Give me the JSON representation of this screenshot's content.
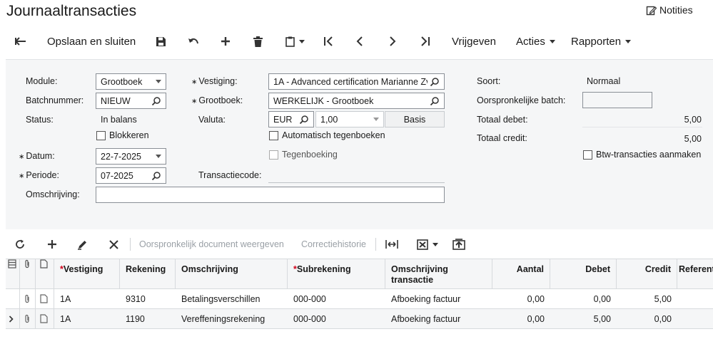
{
  "header": {
    "title": "Journaaltransacties",
    "notes_label": "Notities"
  },
  "toolbar": {
    "save_close": "Opslaan en sluiten",
    "release": "Vrijgeven",
    "actions": "Acties",
    "reports": "Rapporten"
  },
  "form": {
    "module_label": "Module:",
    "module_value": "Grootboek",
    "batch_label": "Batchnummer:",
    "batch_value": "NIEUW",
    "status_label": "Status:",
    "status_value": "In balans",
    "block_label": "Blokkeren",
    "date_label": "Datum:",
    "date_value": "22-7-2025",
    "period_label": "Periode:",
    "period_value": "07-2025",
    "description_label": "Omschrijving:",
    "description_value": "",
    "branch_label": "Vestiging:",
    "branch_value": "1A - Advanced certification Marianne Zv",
    "ledger_label": "Grootboek:",
    "ledger_value": "WERKELIJK - Grootboek",
    "currency_label": "Valuta:",
    "currency_value": "EUR",
    "rate_value": "1,00",
    "basis_label": "Basis",
    "auto_reverse_label": "Automatisch tegenboeken",
    "reversal_label": "Tegenboeking",
    "trans_code_label": "Transactiecode:",
    "type_label": "Soort:",
    "type_value": "Normaal",
    "orig_batch_label": "Oorspronkelijke batch:",
    "total_debit_label": "Totaal debet:",
    "total_debit_value": "5,00",
    "total_credit_label": "Totaal credit:",
    "total_credit_value": "5,00",
    "vat_label": "Btw-transacties aanmaken"
  },
  "gridbar": {
    "orig_doc": "Oorspronkelijk document weergeven",
    "corr_history": "Correctiehistorie"
  },
  "grid": {
    "columns": {
      "branch": "Vestiging",
      "account": "Rekening",
      "description": "Omschrijving",
      "subaccount": "Subrekening",
      "trans_desc": "Omschrijving transactie",
      "qty": "Aantal",
      "debit": "Debet",
      "credit": "Credit",
      "ref": "Referent"
    },
    "rows": [
      {
        "branch": "1A",
        "account": "9310",
        "description": "Betalingsverschillen",
        "subaccount": "000-000",
        "trans_desc": "Afboeking factuur",
        "qty": "0,00",
        "debit": "0,00",
        "credit": "5,00"
      },
      {
        "branch": "1A",
        "account": "1190",
        "description": "Vereffeningsrekening",
        "subaccount": "000-000",
        "trans_desc": "Afboeking factuur",
        "qty": "0,00",
        "debit": "5,00",
        "credit": "0,00"
      }
    ]
  }
}
